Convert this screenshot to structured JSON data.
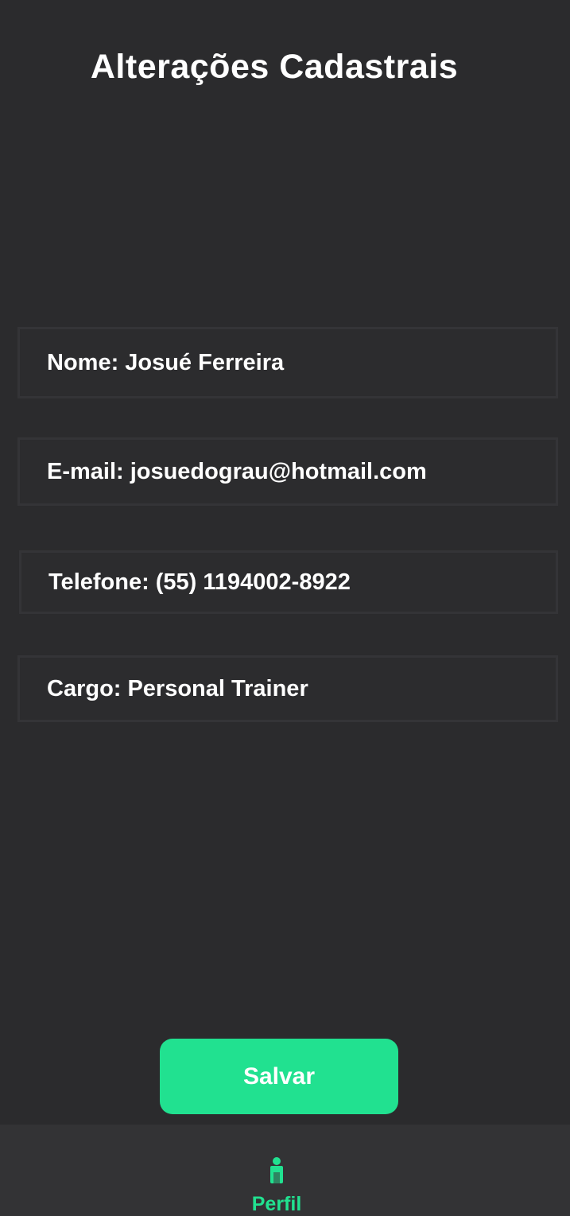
{
  "header": {
    "title": "Alterações Cadastrais"
  },
  "form": {
    "fields": [
      {
        "label": "Nome:",
        "value": "Josué Ferreira"
      },
      {
        "label": "E-mail:",
        "value": "josuedograu@hotmail.com"
      },
      {
        "label": "Telefone:",
        "value": "(55) 1194002-8922"
      },
      {
        "label": "Cargo:",
        "value": "Personal Trainer"
      }
    ]
  },
  "actions": {
    "save_label": "Salvar"
  },
  "bottom_nav": {
    "items": [
      {
        "label": "Perfil",
        "icon": "person-icon",
        "active": true
      }
    ]
  },
  "colors": {
    "background": "#2b2b2d",
    "accent": "#21e190",
    "field_border": "#343437",
    "nav_background": "#333335"
  }
}
